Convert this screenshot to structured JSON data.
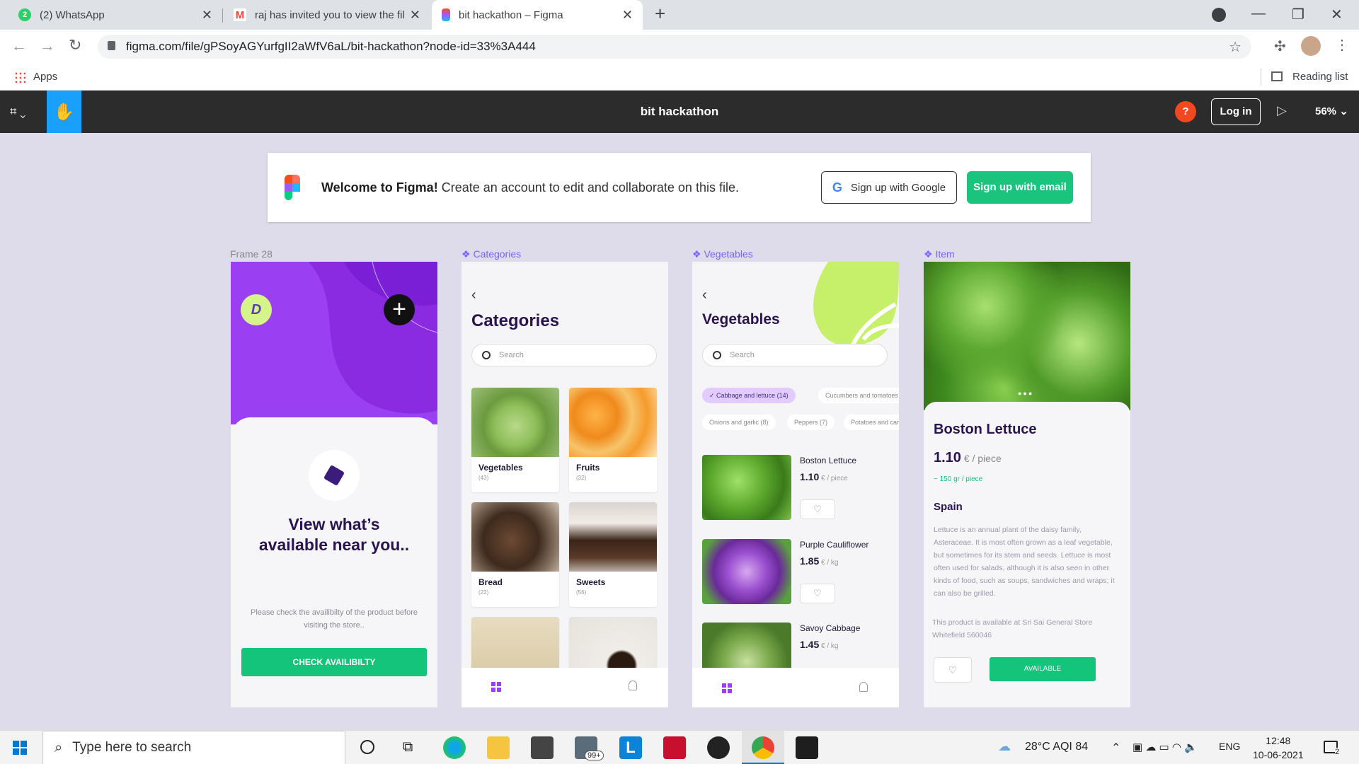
{
  "browser": {
    "tabs": [
      {
        "title": "(2) WhatsApp",
        "favicon": "whatsapp-icon"
      },
      {
        "title": "raj has invited you to view the file",
        "favicon": "gmail-icon"
      },
      {
        "title": "bit hackathon – Figma",
        "favicon": "figma-icon",
        "active": true
      }
    ],
    "url": "figma.com/file/gPSoyAGYurfgII2aWfV6aL/bit-hackathon?node-id=33%3A444",
    "bookmarks_apps": "Apps",
    "reading_list": "Reading list"
  },
  "figma": {
    "file_title": "bit hackathon",
    "help": "?",
    "login": "Log in",
    "zoom": "56%"
  },
  "banner": {
    "welcome_bold": "Welcome to Figma!",
    "welcome_text": " Create an account to edit and collaborate on this file.",
    "google_btn": "Sign up with Google",
    "email_btn": "Sign up with email"
  },
  "frames": {
    "frame28": {
      "label": "Frame 28",
      "avatar_letter": "D",
      "headline_1": "View what’s",
      "headline_2": "available near you..",
      "note_1": "Please check the availibilty of the product before",
      "note_2": "visiting the store..",
      "cta": "CHECK AVAILIBILTY"
    },
    "categories": {
      "label": "Categories",
      "back": "‹",
      "title": "Categories",
      "search_placeholder": "Search",
      "items": [
        {
          "name": "Vegetables",
          "count": "(43)"
        },
        {
          "name": "Fruits",
          "count": "(32)"
        },
        {
          "name": "Bread",
          "count": "(22)"
        },
        {
          "name": "Sweets",
          "count": "(56)"
        }
      ]
    },
    "vegetables": {
      "label": "Vegetables",
      "back": "‹",
      "title": "Vegetables",
      "search_placeholder": "Search",
      "chips": [
        "Cabbage and lettuce (14)",
        "Cucumbers and tomatoes",
        "Onions and garlic (8)",
        "Peppers (7)",
        "Potatoes and carrots"
      ],
      "items": [
        {
          "name": "Boston Lettuce",
          "price": "1.10",
          "unit": " € / piece"
        },
        {
          "name": "Purple Cauliflower",
          "price": "1.85",
          "unit": " € / kg"
        },
        {
          "name": "Savoy Cabbage",
          "price": "1.45",
          "unit": " € / kg"
        }
      ]
    },
    "item": {
      "label": "Item",
      "title": "Boston Lettuce",
      "price": "1.10",
      "unit": " € / piece",
      "weight": "~ 150 gr / piece",
      "origin": "Spain",
      "description": "Lettuce is an annual plant of the daisy family, Asteraceae. It is most often grown as a leaf vegetable, but sometimes for its stem and seeds. Lettuce is most often used for salads, although it is also seen in other kinds of food, such as soups, sandwiches and wraps; it can also be grilled.",
      "availability": "This product is available at Sri Sai General Store Whitefield 560046",
      "cta": "AVAILABLE"
    }
  },
  "taskbar": {
    "search_placeholder": "Type here to search",
    "mail_badge": "99+",
    "weather": "28°C  AQI 84",
    "lang": "ENG",
    "time": "12:48",
    "date": "10-06-2021",
    "notif_count": "2"
  },
  "colors": {
    "figma_green": "#1bc47d",
    "purple": "#9a3ff2",
    "dark_purple": "#2a1450"
  }
}
